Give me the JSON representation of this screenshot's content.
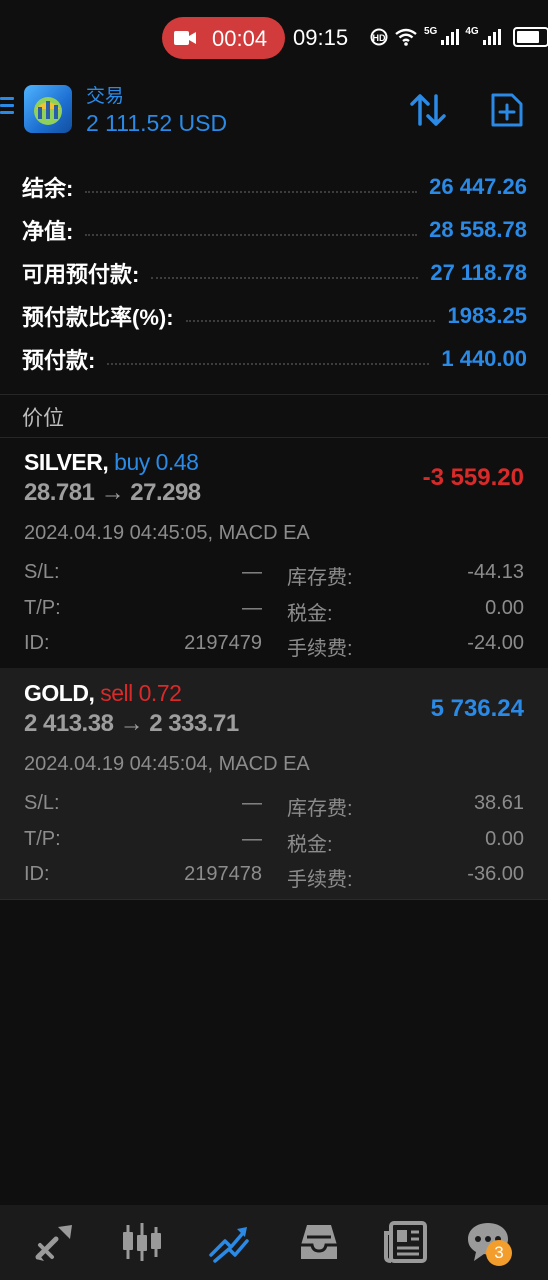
{
  "status_bar": {
    "recording_time": "00:04",
    "clock": "09:15",
    "signal1_label": "5G",
    "signal2_label": "4G",
    "battery_level": 0.8
  },
  "header": {
    "title": "交易",
    "balance": "2 111.52 USD"
  },
  "summary": [
    {
      "label": "结余:",
      "value": "26 447.26"
    },
    {
      "label": "净值:",
      "value": "28 558.78"
    },
    {
      "label": "可用预付款:",
      "value": "27 118.78"
    },
    {
      "label": "预付款比率(%):",
      "value": "1983.25"
    },
    {
      "label": "预付款:",
      "value": "1 440.00"
    }
  ],
  "section_title": "价位",
  "positions": [
    {
      "symbol": "SILVER,",
      "side": "buy 0.48",
      "prices": "28.781 → 27.298",
      "profit": "-3 559.20",
      "meta": "2024.04.19 04:45:05, MACD EA",
      "sl_label": "S/L:",
      "sl_value": "—",
      "tp_label": "T/P:",
      "tp_value": "—",
      "id_label": "ID:",
      "id_value": "2197479",
      "swap_label": "库存费:",
      "swap_value": "-44.13",
      "tax_label": "税金:",
      "tax_value": "0.00",
      "fee_label": "手续费:",
      "fee_value": "-24.00"
    },
    {
      "symbol": "GOLD,",
      "side": "sell 0.72",
      "prices": "2 413.38 → 2 333.71",
      "profit": "5 736.24",
      "meta": "2024.04.19 04:45:04, MACD EA",
      "sl_label": "S/L:",
      "sl_value": "—",
      "tp_label": "T/P:",
      "tp_value": "—",
      "id_label": "ID:",
      "id_value": "2197478",
      "swap_label": "库存费:",
      "swap_value": "38.61",
      "tax_label": "税金:",
      "tax_value": "0.00",
      "fee_label": "手续费:",
      "fee_value": "-36.00"
    }
  ],
  "bottom_nav": {
    "items": [
      "quotes-icon",
      "chart-icon",
      "trade-icon",
      "history-icon",
      "news-icon",
      "chat-icon"
    ],
    "active": "trade-icon",
    "chat_badge": "3"
  },
  "colors": {
    "accent": "#2a8ae6",
    "loss": "#d92a2a",
    "recording": "#d23b3b",
    "badge": "#f29d2c"
  }
}
